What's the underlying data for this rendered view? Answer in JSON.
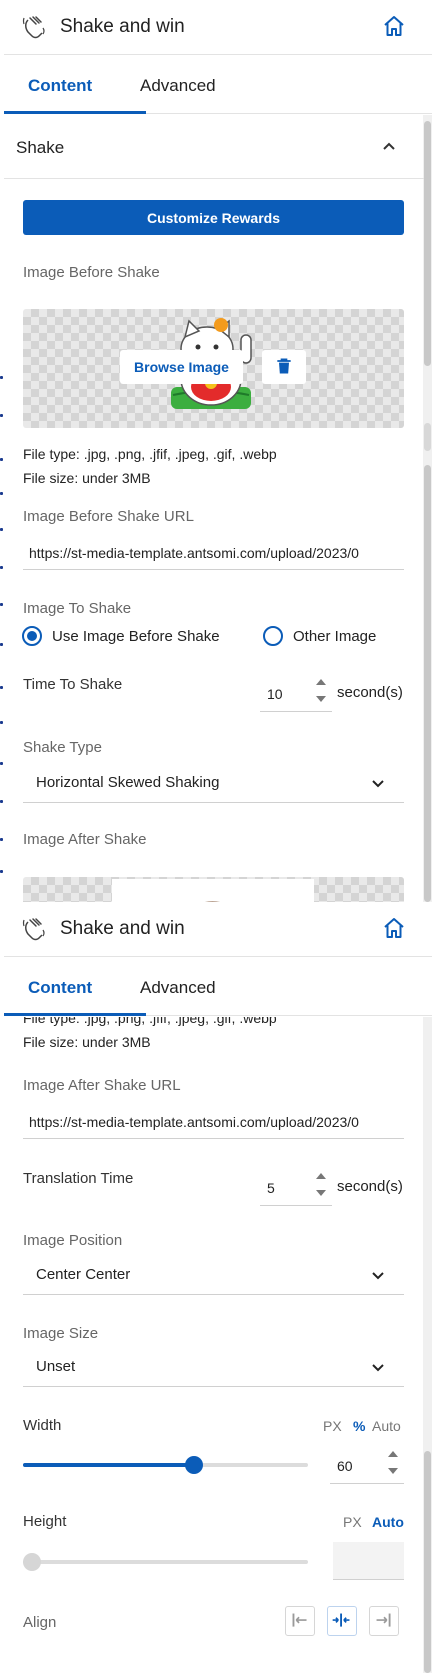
{
  "colors": {
    "accent": "#0b5cb8",
    "muted": "#666666",
    "border": "#d0d0d0"
  },
  "header": {
    "title": "Shake and win",
    "logo_icon": "shake-hand-logo-icon",
    "home_icon": "home-icon"
  },
  "tabs": [
    {
      "label": "Content",
      "active": true
    },
    {
      "label": "Advanced",
      "active": false
    }
  ],
  "panel1": {
    "section": {
      "label": "Shake",
      "icon": "chevron-up-icon"
    },
    "customize_button": "Customize Rewards",
    "image_before": {
      "label": "Image Before Shake",
      "browse_label": "Browse Image",
      "delete_icon": "trash-icon",
      "file_type": "File type: .jpg, .png, .jfif, .jpeg, .gif, .webp",
      "file_size": "File size: under 3MB"
    },
    "url_label": "Image Before Shake URL",
    "url_value": "https://st-media-template.antsomi.com/upload/2023/0",
    "image_to_shake": {
      "label": "Image To Shake",
      "options": [
        {
          "label": "Use Image Before Shake",
          "selected": true
        },
        {
          "label": "Other Image",
          "selected": false
        }
      ]
    },
    "time_to_shake": {
      "label": "Time To Shake",
      "value": "10",
      "unit": "second(s)"
    },
    "shake_type": {
      "label": "Shake Type",
      "value": "Horizontal Skewed Shaking"
    },
    "image_after_label": "Image After Shake"
  },
  "panel2": {
    "file_type": "File type: .jpg, .png, .jfif, .jpeg, .gif, .webp",
    "file_size": "File size: under 3MB",
    "url_label": "Image After Shake URL",
    "url_value": "https://st-media-template.antsomi.com/upload/2023/0",
    "translation_time": {
      "label": "Translation Time",
      "value": "5",
      "unit": "second(s)"
    },
    "image_position": {
      "label": "Image Position",
      "value": "Center Center"
    },
    "image_size": {
      "label": "Image Size",
      "value": "Unset"
    },
    "width": {
      "label": "Width",
      "units": [
        "PX",
        "%",
        "Auto"
      ],
      "active_unit": "%",
      "value": "60",
      "slider_percent": 60
    },
    "height": {
      "label": "Height",
      "units": [
        "PX",
        "Auto"
      ],
      "active_unit": "Auto",
      "slider_percent": 0
    },
    "align": {
      "label": "Align",
      "options": [
        "align-left-icon",
        "align-center-icon",
        "align-right-icon"
      ],
      "active": "align-center-icon"
    }
  }
}
